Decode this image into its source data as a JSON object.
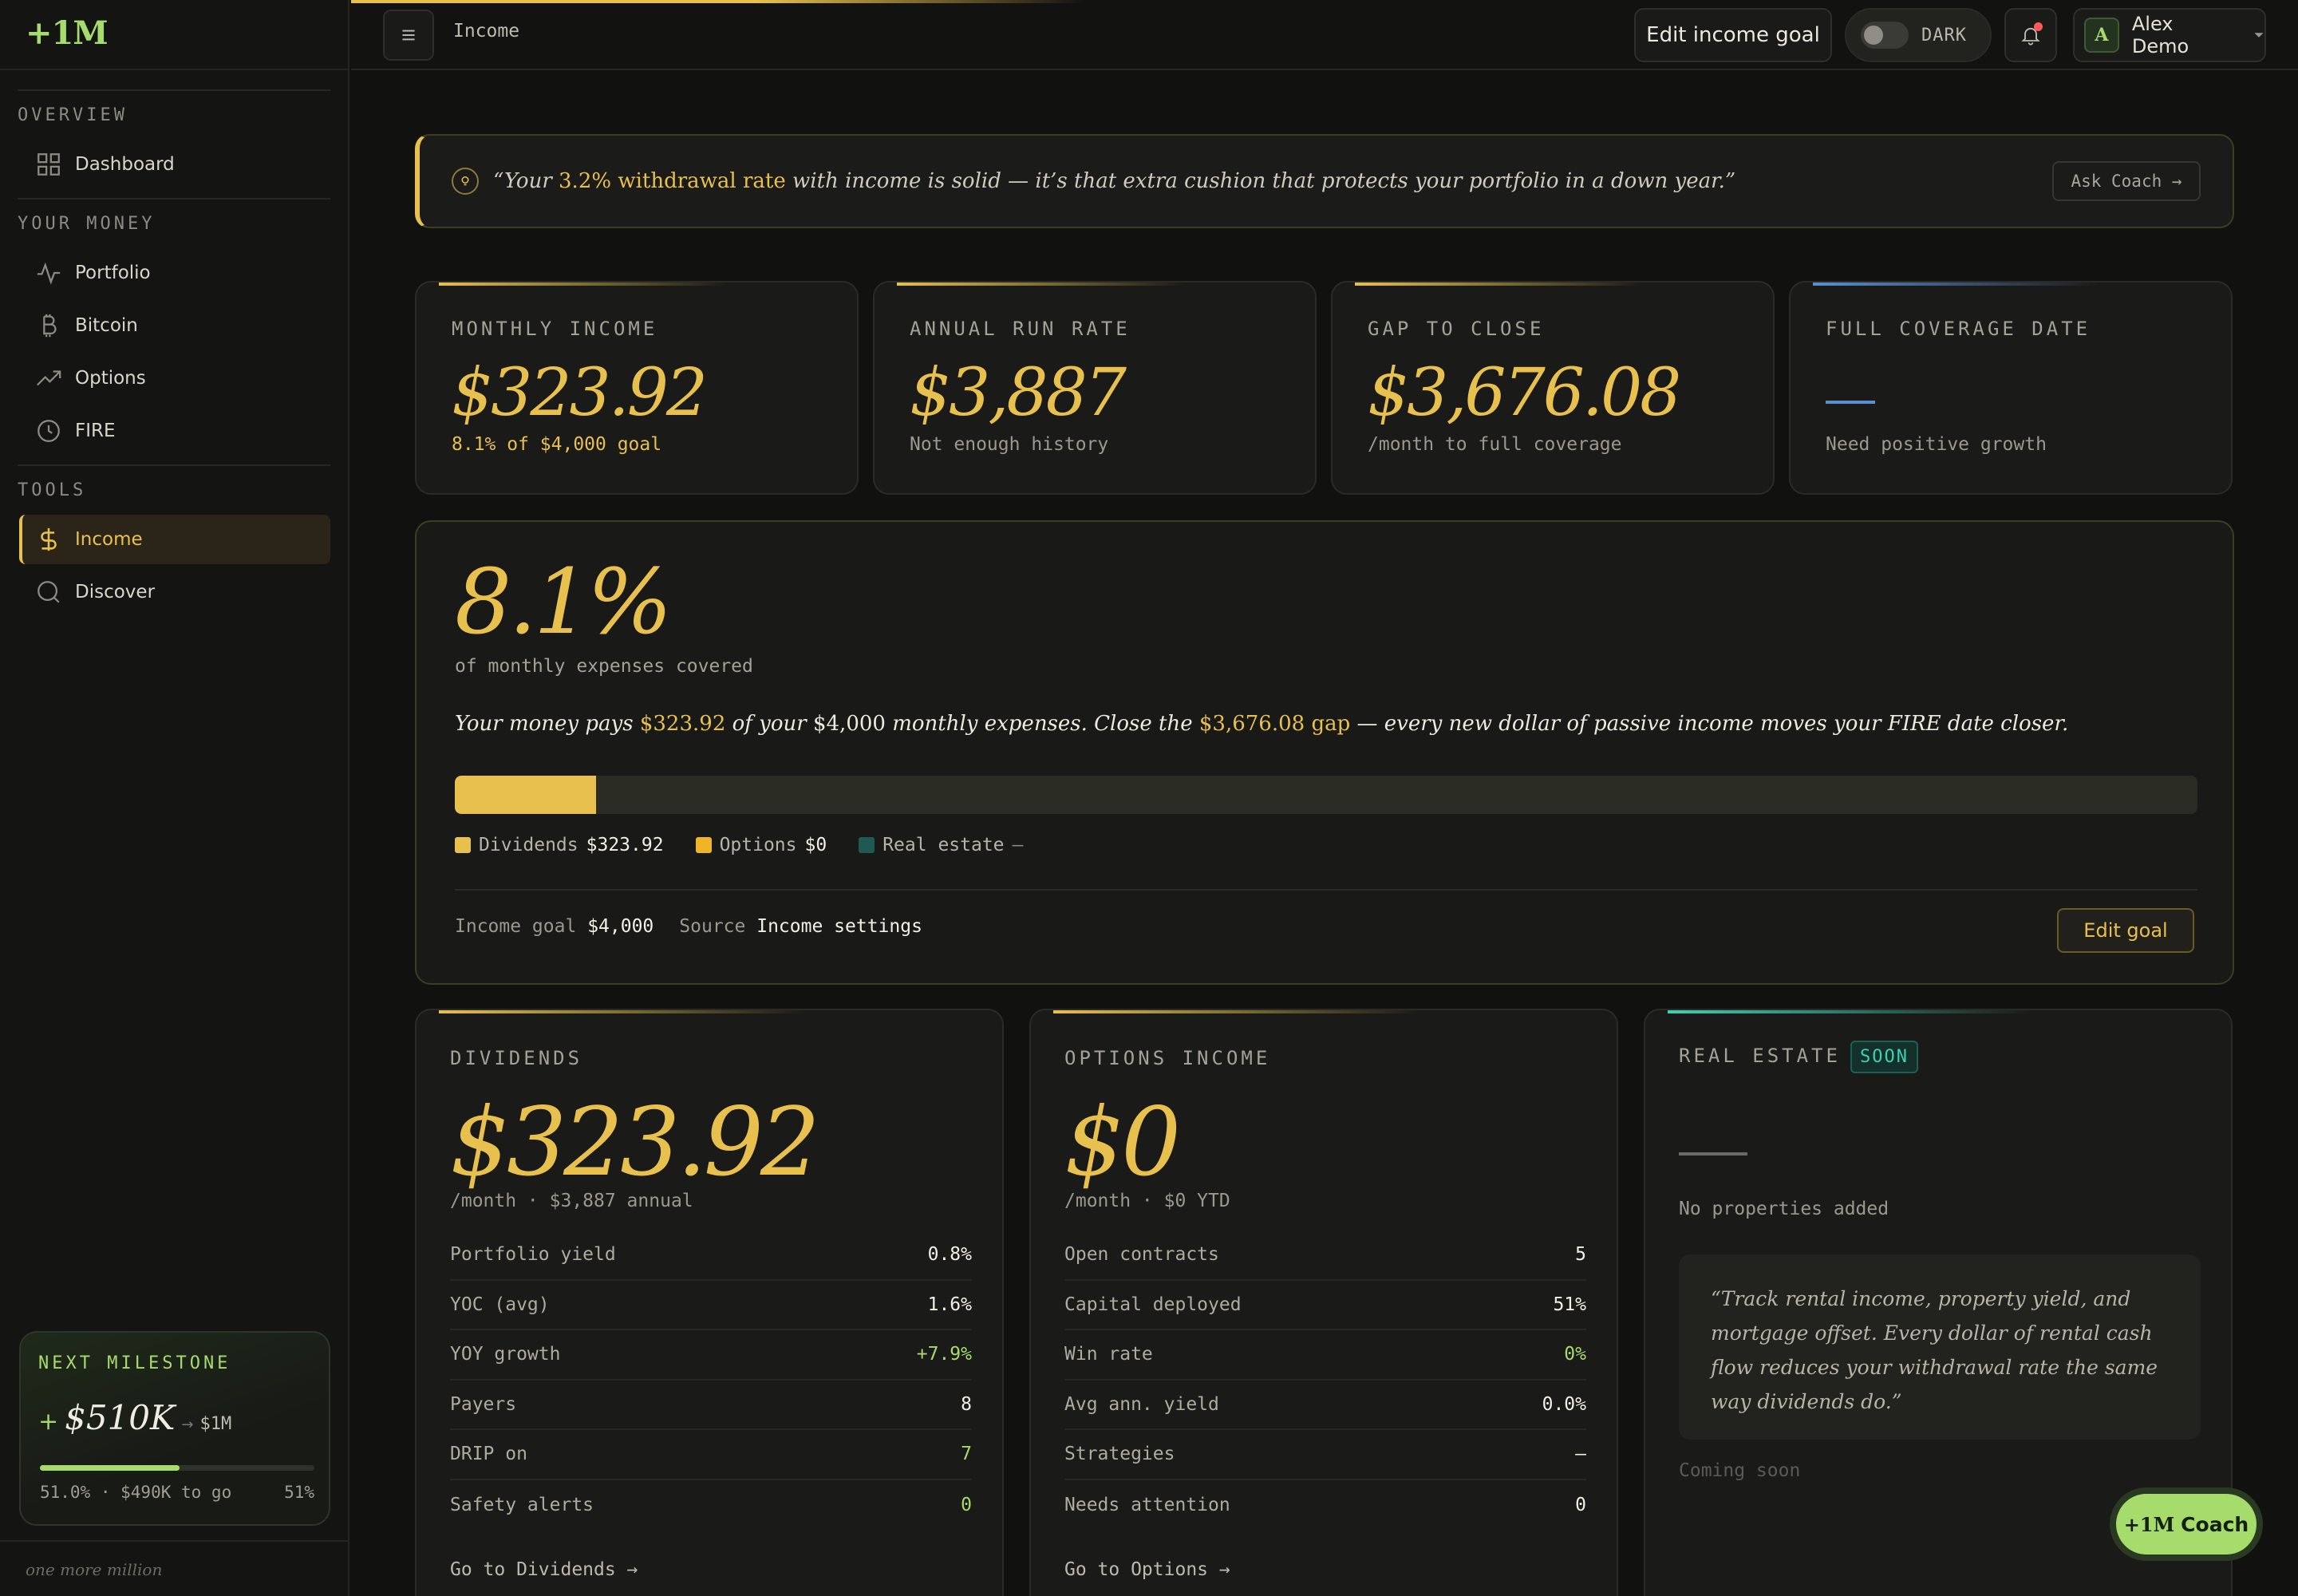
{
  "sidebar": {
    "brand": "+1M",
    "sections": {
      "overview": "OVERVIEW",
      "your_money": "YOUR MONEY",
      "tools": "TOOLS"
    },
    "items": {
      "dashboard": "Dashboard",
      "portfolio": "Portfolio",
      "bitcoin": "Bitcoin",
      "options": "Options",
      "fire": "FIRE",
      "income": "Income",
      "discover": "Discover"
    },
    "active_item": "Income",
    "milestone": {
      "title": "NEXT MILESTONE",
      "plus": "+",
      "value": "$510K",
      "arrow": "→",
      "target": "$1M",
      "progress_fraction": 0.51,
      "left": "51.0% · $490K to go",
      "right": "51%"
    },
    "tagline": "one more million"
  },
  "header": {
    "title": "Income",
    "edit_goal": "Edit income goal",
    "theme_label": "DARK",
    "user_initial": "A",
    "user_name": "Alex Demo",
    "notifications_unread": true
  },
  "coach_quote": {
    "open": "“Your ",
    "highlight": "3.2% withdrawal rate",
    "rest": " with income is solid — it’s that extra cushion that protects your portfolio in a down year.”",
    "button": "Ask Coach →"
  },
  "stats": {
    "monthly_income": {
      "label": "MONTHLY INCOME",
      "value": "$323.92",
      "sub": "8.1% of $4,000 goal"
    },
    "annual_run_rate": {
      "label": "ANNUAL RUN RATE",
      "value": "$3,887",
      "sub": "Not enough history"
    },
    "gap_to_close": {
      "label": "GAP TO CLOSE",
      "value": "$3,676.08",
      "sub": "/month to full coverage"
    },
    "full_coverage_date": {
      "label": "FULL COVERAGE DATE",
      "value": "",
      "sub": "Need positive growth"
    }
  },
  "coverage": {
    "percent": "8.1%",
    "percent_value": 8.1,
    "subtitle": "of monthly expenses covered",
    "sentence": {
      "a": "Your money pays ",
      "amount": "$323.92",
      "b": " of your ",
      "expenses": "$4,000",
      "c": " monthly expenses. Close the ",
      "gap": "$3,676.08 gap",
      "d": " — every new dollar of passive income moves your FIRE date closer."
    },
    "legend": [
      {
        "name": "Dividends",
        "amount": "$323.92",
        "color": "#e8c04d"
      },
      {
        "name": "Options",
        "amount": "$0",
        "color": "#f0b429"
      },
      {
        "name": "Real estate",
        "amount": "—",
        "color": "#1f5a52"
      }
    ],
    "footer": {
      "goal_label": "Income goal",
      "goal_value": "$4,000",
      "source_label": "Source",
      "source_value": "Income settings"
    },
    "edit_button": "Edit goal"
  },
  "dividends": {
    "label": "DIVIDENDS",
    "value": "$323.92",
    "sub": "/month · $3,887 annual",
    "rows": [
      {
        "k": "Portfolio yield",
        "v": "0.8%"
      },
      {
        "k": "YOC (avg)",
        "v": "1.6%"
      },
      {
        "k": "YOY growth",
        "v": "+7.9%"
      },
      {
        "k": "Payers",
        "v": "8"
      },
      {
        "k": "DRIP on",
        "v": "7"
      },
      {
        "k": "Safety alerts",
        "v": "0"
      }
    ],
    "link": "Go to Dividends →"
  },
  "options_income": {
    "label": "OPTIONS INCOME",
    "value": "$0",
    "sub": "/month · $0 YTD",
    "rows": [
      {
        "k": "Open contracts",
        "v": "5"
      },
      {
        "k": "Capital deployed",
        "v": "51%"
      },
      {
        "k": "Win rate",
        "v": "0%"
      },
      {
        "k": "Avg ann. yield",
        "v": "0.0%"
      },
      {
        "k": "Strategies",
        "v": "—"
      },
      {
        "k": "Needs attention",
        "v": "0"
      }
    ],
    "link": "Go to Options →"
  },
  "real_estate": {
    "label": "REAL ESTATE",
    "badge": "SOON",
    "sub": "No properties added",
    "quote": "“Track rental income, property yield, and mortgage offset. Every dollar of rental cash flow reduces your withdrawal rate the same way dividends do.”",
    "soon": "Coming soon"
  },
  "coach_fab": {
    "brand": "+1M",
    "label": "Coach"
  },
  "colors": {
    "gold": "#e8c04d",
    "green": "#a6dc6b",
    "teal": "#3fd1b4",
    "blue": "#5b8fd4",
    "background": "#111110"
  }
}
